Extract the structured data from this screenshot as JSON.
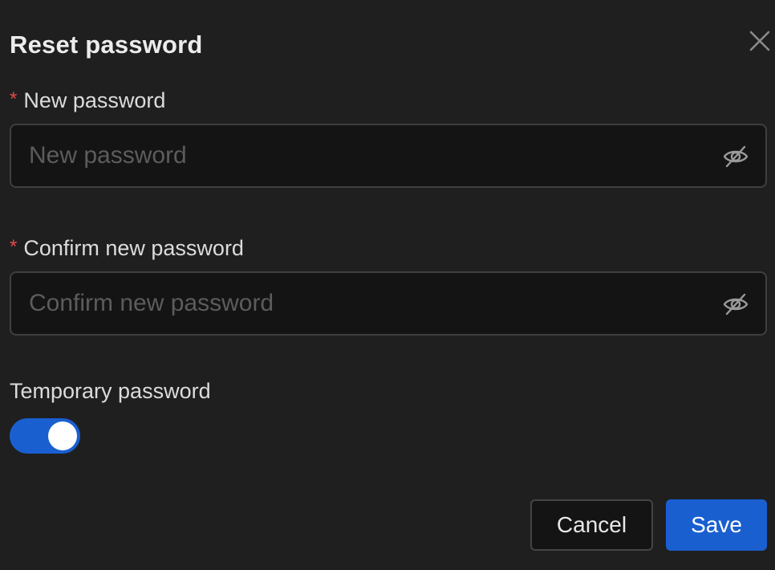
{
  "dialog": {
    "title": "Reset password",
    "close_icon": "close-icon"
  },
  "form": {
    "new_password": {
      "label": "New password",
      "required_mark": "*",
      "placeholder": "New password",
      "value": "",
      "visibility_icon": "eye-off-icon"
    },
    "confirm_password": {
      "label": "Confirm new password",
      "required_mark": "*",
      "placeholder": "Confirm new password",
      "value": "",
      "visibility_icon": "eye-off-icon"
    },
    "temporary": {
      "label": "Temporary password",
      "enabled": true
    }
  },
  "actions": {
    "cancel_label": "Cancel",
    "save_label": "Save"
  },
  "colors": {
    "background": "#1f1f1f",
    "accent": "#1a5fd0",
    "required": "#e5484d"
  }
}
